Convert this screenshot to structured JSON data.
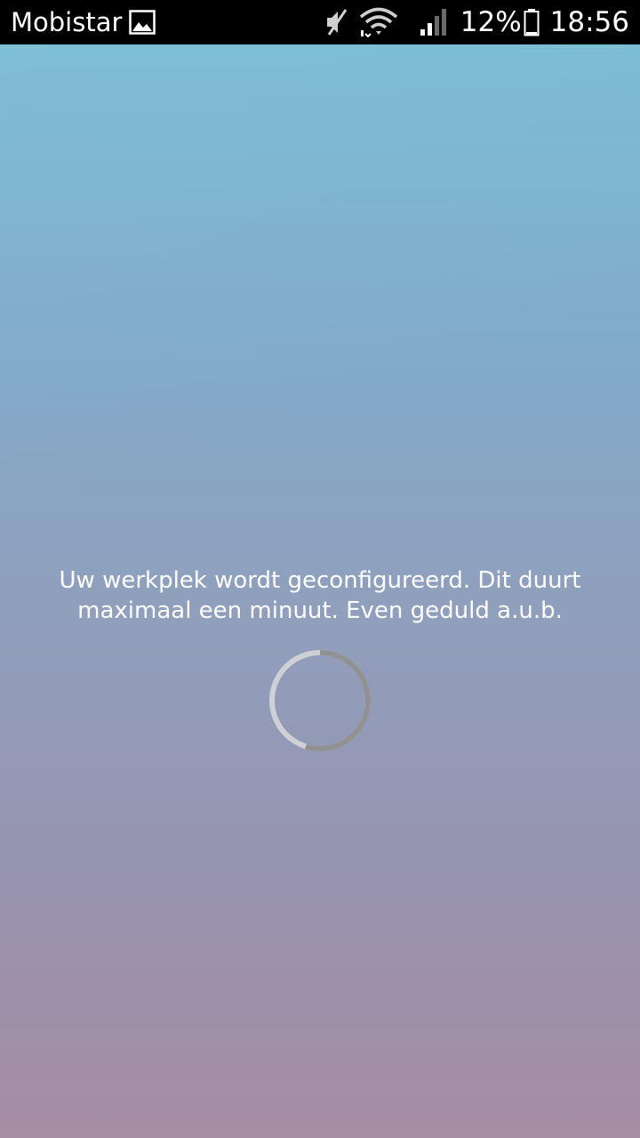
{
  "status_bar": {
    "carrier": "Mobistar",
    "battery_percent": "12%",
    "time": "18:56",
    "icons": [
      "picture-notification-icon",
      "muted-icon",
      "wifi-icon",
      "signal-icon",
      "battery-icon"
    ]
  },
  "screen": {
    "message": "Uw werkplek wordt geconfigureerd. Dit duurt maximaal een minuut. Even geduld a.u.b.",
    "background_top_color": "#79bcd3",
    "background_bottom_color": "#a68ea4"
  },
  "spinner": {
    "icon": "loading-spinner-icon"
  }
}
